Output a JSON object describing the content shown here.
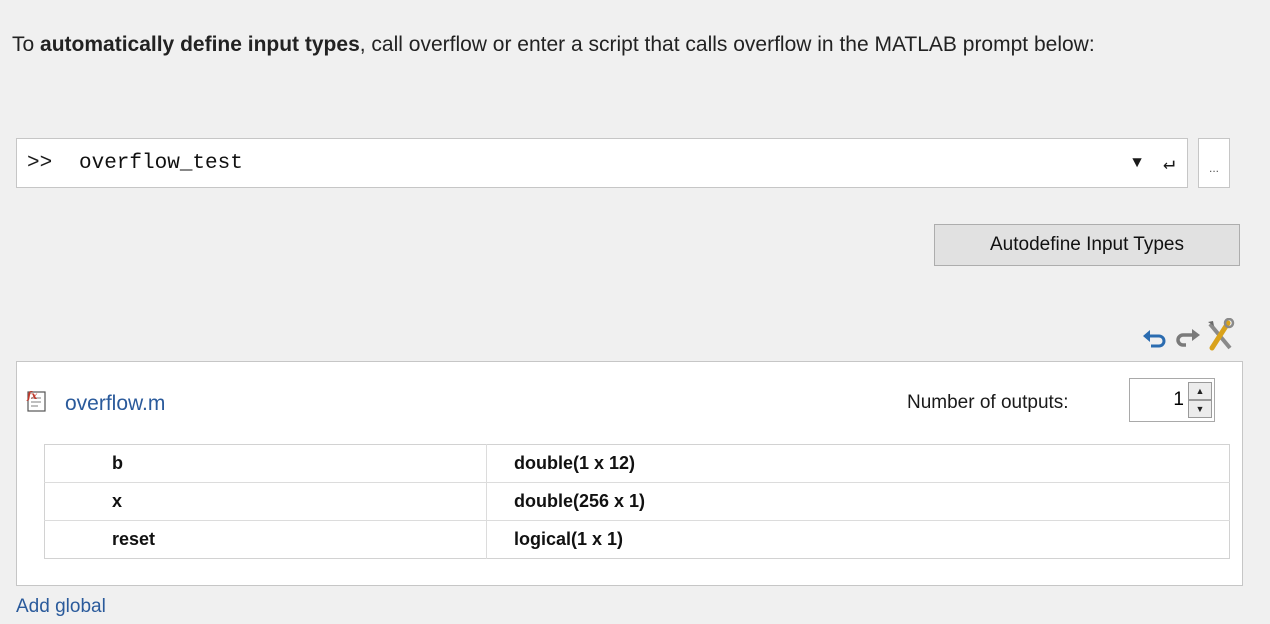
{
  "intro": {
    "prefix": "To ",
    "emphasis": "automatically define input types",
    "suffix": ", call overflow or enter a script that calls overflow in the MATLAB prompt below:"
  },
  "prompt": {
    "marker": ">>",
    "value": "overflow_test",
    "history_icon": "dropdown-arrow-icon",
    "enter_icon": "enter-return-icon",
    "more_label": "..."
  },
  "autodefine_button": {
    "label": "Autodefine Input Types"
  },
  "toolbar": {
    "icons": [
      "undo-icon",
      "redo-icon",
      "tools-icon"
    ],
    "colors": {
      "undo": "#2b6cb0",
      "redo": "#7a7a7a",
      "tools_handle": "#d9a21b"
    }
  },
  "function_panel": {
    "name": "overflow.m",
    "icon": "function-file-icon",
    "outputs_label": "Number of outputs:",
    "outputs_value": "1",
    "inputs": [
      {
        "name": "b",
        "type": "double(1 x 12)"
      },
      {
        "name": "x",
        "type": "double(256 x 1)"
      },
      {
        "name": "reset",
        "type": "logical(1 x 1)"
      }
    ]
  },
  "add_global_link": "Add global",
  "colors": {
    "link": "#2a5a9b",
    "background": "#f0f0f0",
    "border": "#c6c6c6"
  }
}
